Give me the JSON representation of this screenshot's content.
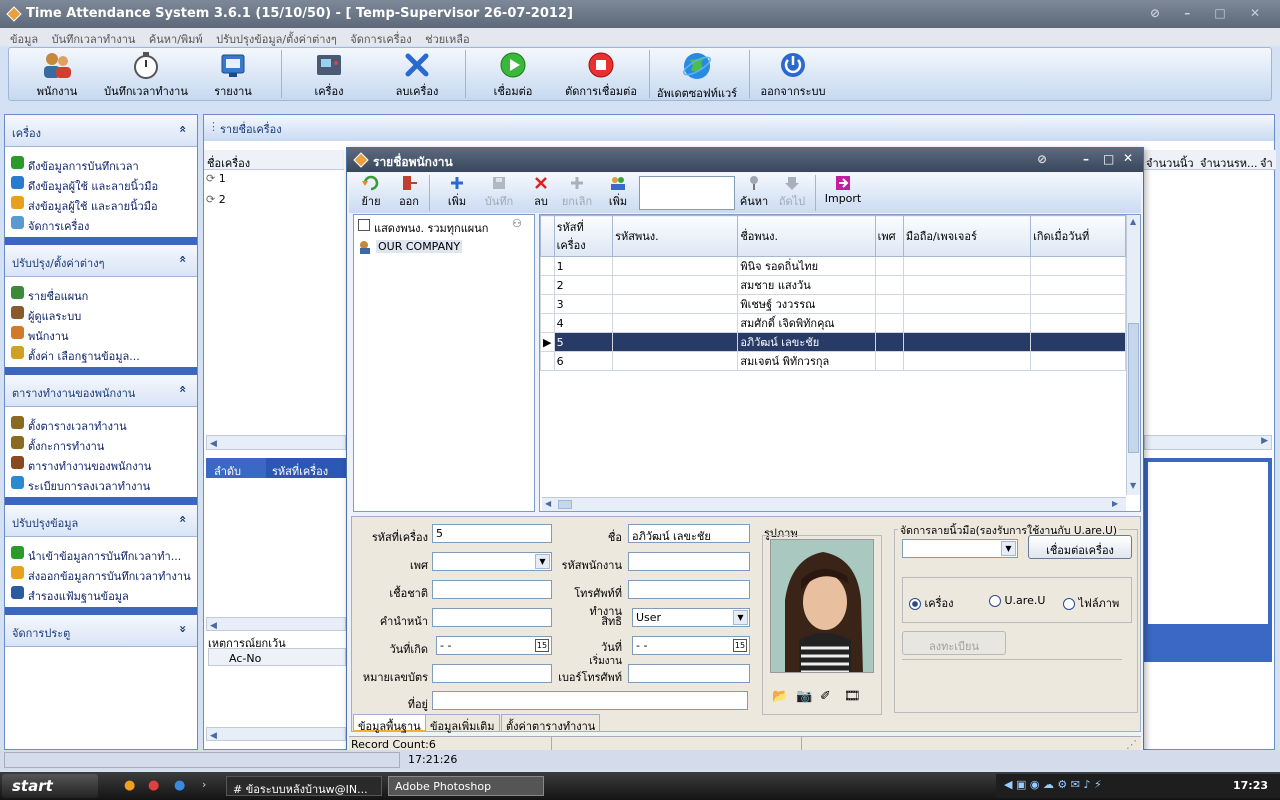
{
  "window": {
    "title": "Time Attendance System 3.6.1 (15/10/50) - [ Temp-Supervisor 26-07-2012]"
  },
  "menu": [
    "ข้อมูล",
    "บันทึกเวลาทำงาน",
    "ค้นหา/พิมพ์",
    "ปรับปรุงข้อมูล/ตั้งค่าต่างๆ",
    "จัดการเครื่อง",
    "ช่วยเหลือ"
  ],
  "toolbar": {
    "employees": "พนักงาน",
    "record_time": "บันทึกเวลาทำงาน",
    "report": "รายงาน",
    "machine": "เครื่อง",
    "delete_machine": "ลบเครื่อง",
    "connect": "เชื่อมต่อ",
    "disconnect": "ตัดการเชื่อมต่อ",
    "update_software": "อัพเดตซอฟท์แวร์",
    "exit": "ออกจากระบบ"
  },
  "sidebar": {
    "sections": [
      {
        "title": "เครื่อง",
        "chevron": "«",
        "items": [
          {
            "label": "ดึงข้อมูลการบันทึกเวลา",
            "icon": "down-arrow-icon",
            "color": "#2a9a2a"
          },
          {
            "label": "ดึงข้อมูลผู้ใช้ และลายนิ้วมือ",
            "icon": "globe-icon",
            "color": "#2a7ad0"
          },
          {
            "label": "ส่งข้อมูลผู้ใช้ และลายนิ้วมือ",
            "icon": "up-arrow-icon",
            "color": "#e8a020"
          },
          {
            "label": "จัดการเครื่อง",
            "icon": "network-icon",
            "color": "#5a9ad0"
          }
        ]
      },
      {
        "title": "ปรับปรุง/ตั้งค่าต่างๆ",
        "chevron": "«",
        "items": [
          {
            "label": "รายชื่อแผนก",
            "icon": "department-icon",
            "color": "#3a8a3a"
          },
          {
            "label": "ผู้ดูแลระบบ",
            "icon": "admin-icon",
            "color": "#8a5a2a"
          },
          {
            "label": "พนักงาน",
            "icon": "employees-icon",
            "color": "#d07a2a"
          },
          {
            "label": "ตั้งค่า เลือกฐานข้อมูล...",
            "icon": "lock-icon",
            "color": "#d0a020"
          }
        ]
      },
      {
        "title": "ตารางทำงานของพนักงาน",
        "chevron": "«",
        "items": [
          {
            "label": "ตั้งตารางเวลาทำงาน",
            "icon": "schedule-icon",
            "color": "#8a6a20"
          },
          {
            "label": "ตั้งกะการทำงาน",
            "icon": "shift-icon",
            "color": "#8a6a20"
          },
          {
            "label": "ตารางทำงานของพนักงาน",
            "icon": "roster-icon",
            "color": "#8a4a20"
          },
          {
            "label": "ระเบียบการลงเวลาทำงาน",
            "icon": "rules-icon",
            "color": "#2a8ad0"
          }
        ]
      },
      {
        "title": "ปรับปรุงข้อมูล",
        "chevron": "«",
        "items": [
          {
            "label": "นำเข้าข้อมูลการบันทึกเวลาทำ...",
            "icon": "import-icon",
            "color": "#2a9a2a"
          },
          {
            "label": "ส่งออกข้อมูลการบันทึกเวลาทำงาน",
            "icon": "export-icon",
            "color": "#e8a020"
          },
          {
            "label": "สำรองแฟ้มฐานข้อมูล",
            "icon": "backup-icon",
            "color": "#2a5aa0"
          }
        ]
      },
      {
        "title": "จัดการประตู",
        "chevron": "»",
        "items": []
      }
    ]
  },
  "main": {
    "panel_title": "รายชื่อเครื่อง",
    "device_col": "ชื่อเครื่อง",
    "devices": [
      "1",
      "2"
    ],
    "right_cols": [
      "จำนวนนิ้ว",
      "จำนวนรห...",
      "จำ"
    ],
    "lower_cols": [
      "ลำดับ",
      "รหัสที่เครื่อง"
    ],
    "exceptions_title": "เหตุการณ์ยกเว้น",
    "exceptions_col": "Ac-No"
  },
  "dialog": {
    "title": "รายชื่อพนักงาน",
    "toolbar": {
      "move": "ย้าย",
      "leave": "ออก",
      "add": "เพิ่ม",
      "save": "บันทึก",
      "delete": "ลบ",
      "cancel": "ยกเลิก",
      "add2": "เพิ่ม",
      "search": "ค้นหา",
      "next": "ถัดไป",
      "import": "Import"
    },
    "tree": {
      "show_all_label": "แสดงพนง. รวมทุกแผนก",
      "root": "OUR COMPANY"
    },
    "grid": {
      "columns": [
        "รหัสที่เครื่อง",
        "รหัสพนง.",
        "ชื่อพนง.",
        "เพศ",
        "มือถือ/เพจเจอร์",
        "เกิดเมื่อวันที่"
      ],
      "rows": [
        {
          "id": "1",
          "emp": "",
          "name": "พินิจ รอดถิ่นไทย",
          "selected": false
        },
        {
          "id": "2",
          "emp": "",
          "name": "สมชาย แสงวัน",
          "selected": false
        },
        {
          "id": "3",
          "emp": "",
          "name": "พิเชษฐ์ วงวรรณ",
          "selected": false
        },
        {
          "id": "4",
          "emp": "",
          "name": "สมศักดิ์ เจิดพิทักคุณ",
          "selected": false
        },
        {
          "id": "5",
          "emp": "",
          "name": "อภิวัฒน์ เลขะชัย",
          "selected": true
        },
        {
          "id": "6",
          "emp": "",
          "name": "สมเจตน์ พิทักวรกุล",
          "selected": false
        }
      ]
    },
    "form": {
      "machine_id_label": "รหัสที่เครื่อง",
      "machine_id": "5",
      "name_label": "ชื่อ",
      "name": "อภิวัฒน์ เลขะชัย",
      "gender_label": "เพศ",
      "emp_id_label": "รหัสพนักงาน",
      "nationality_label": "เชื้อชาติ",
      "office_phone_label": "โทรศัพท์ที่ทำงาน",
      "title_label": "คำนำหน้า",
      "privilege_label": "สิทธิ",
      "privilege": "User",
      "birth_label": "วันที่เกิด",
      "birth": "- -",
      "start_label": "วันที่",
      "start_label2": "เริ่มงาน",
      "start": "- -",
      "idcard_label": "หมายเลขบัตร",
      "phone_label": "เบอร์โทรศัพท์",
      "address_label": "ที่อยู่",
      "photo_label": "รูปภาพ",
      "fp_group": "จัดการลายนิ้วมือ(รองรับการใช้งานกับ U.are.U)",
      "connect_btn": "เชื่อมต่อเครื่อง",
      "radios": [
        "เครื่อง",
        "U.are.U",
        "ไฟล์ภาพ"
      ],
      "register_btn": "ลงทะเบียน"
    },
    "tabs": [
      "ข้อมูลพื้นฐาน",
      "ข้อมูลเพิ่มเติม",
      "ตั้งค่าตารางทำงาน"
    ],
    "status": "Record Count:6"
  },
  "statusbar": {
    "time": "17:21:26"
  },
  "taskbar": {
    "start": "start",
    "items": [
      "# ข้อระบบหลังบ้านw@IN...",
      "Adobe Photoshop"
    ],
    "clock": "17:23"
  }
}
